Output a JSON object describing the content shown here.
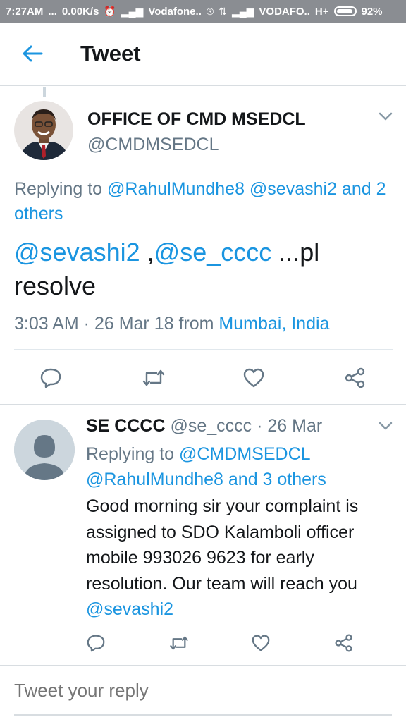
{
  "status_bar": {
    "time": "7:27AM",
    "dots": "...",
    "speed": "0.00K/s",
    "carrier1": "Vodafone..",
    "carrier2": "VODAFO..",
    "network": "H+",
    "battery": "92%"
  },
  "app_bar": {
    "title": "Tweet",
    "back_icon": "back-arrow-icon"
  },
  "main_tweet": {
    "name": "OFFICE OF CMD MSEDCL",
    "handle": "@CMDMSEDCL",
    "replying_prefix": "Replying to ",
    "replying_link": "@RahulMundhe8 @sevashi2 and 2 others",
    "text_mention1": "@sevashi2",
    "text_sep": " ,",
    "text_mention2": "@se_cccc",
    "text_rest": " ...pl resolve",
    "time": "3:03 AM · 26 Mar 18 from ",
    "location": "Mumbai, India"
  },
  "reply_tweet": {
    "name": "SE CCCC",
    "handle_time": " @se_cccc · 26 Mar",
    "replying_prefix": "Replying to ",
    "replying_link1": "@CMDMSEDCL",
    "replying_link2": "@RahulMundhe8 and 3 others",
    "body": "Good morning sir your complaint is assigned to SDO Kalamboli officer mobile 993026 9623 for early resolution. Our team will reach you ",
    "body_mention": "@sevashi2"
  },
  "compose": {
    "placeholder": "Tweet your reply"
  },
  "colors": {
    "link": "#1b95e0",
    "secondary_text": "#657786",
    "icon": "#657786",
    "status_bar": "#8a8d92"
  },
  "icons": [
    "back-arrow-icon",
    "chevron-down-icon",
    "reply-icon",
    "retweet-icon",
    "like-icon",
    "share-icon"
  ]
}
